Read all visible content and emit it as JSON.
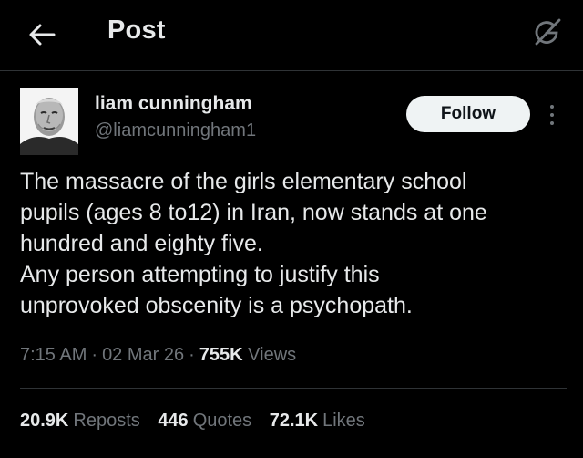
{
  "header": {
    "title": "Post",
    "back_icon": "arrow-left-icon",
    "grok_icon": "grok-icon"
  },
  "author": {
    "display_name": "liam cunningham",
    "handle": "@liamcunningham1",
    "follow_label": "Follow",
    "more_icon": "more-vertical-icon"
  },
  "tweet": {
    "lines": [
      "The massacre of the girls elementary school",
      "pupils (ages 8 to12) in Iran, now stands at one",
      "hundred and eighty five.",
      "Any person attempting to justify this",
      "unprovoked obscenity is a psychopath."
    ]
  },
  "meta": {
    "time": "7:15 AM",
    "separator": "·",
    "date": "02 Mar 26",
    "views_count": "755K",
    "views_label": "Views"
  },
  "stats": {
    "reposts_count": "20.9K",
    "reposts_label": "Reposts",
    "quotes_count": "446",
    "quotes_label": "Quotes",
    "likes_count": "72.1K",
    "likes_label": "Likes"
  },
  "colors": {
    "background": "#000000",
    "text_primary": "#e7e9ea",
    "text_secondary": "#71767b",
    "follow_bg": "#eff3f4",
    "divider": "#2f3336"
  }
}
